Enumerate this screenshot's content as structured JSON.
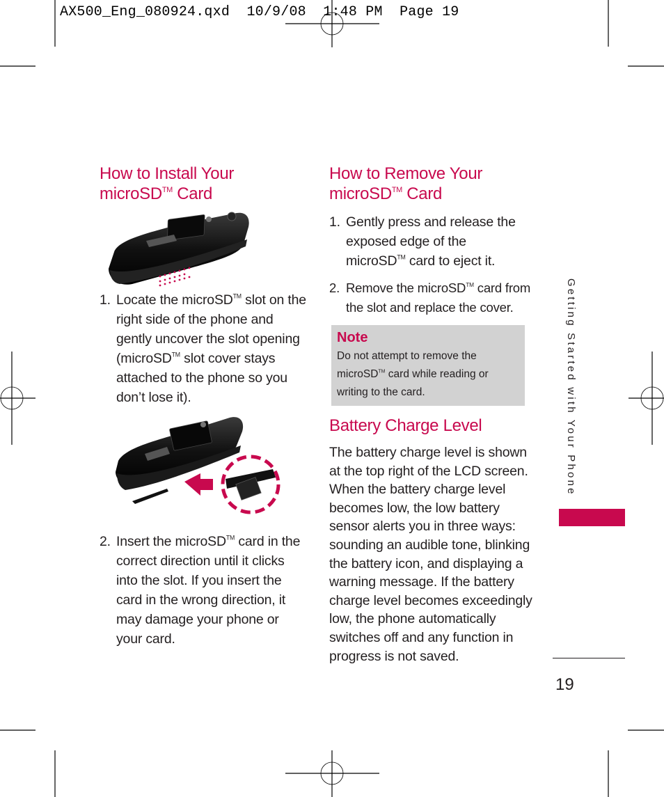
{
  "slug": {
    "text": "AX500_Eng_080924.qxd  10/9/08  1:48 PM  Page 19"
  },
  "colors": {
    "accent": "#c8094e",
    "note_bg": "#d2d2d2",
    "text": "#231f20"
  },
  "install": {
    "heading_line1": "How to Install Your",
    "heading_line2_pre": "microSD",
    "heading_tm": "TM",
    "heading_line2_post": " Card",
    "image1_alt": "Closed flip phone with microSD slot edge highlighted by dotted line",
    "step1": {
      "num": "1.",
      "part1": "Locate the microSD",
      "tm": "TM",
      "part2": " slot on the right side of the phone and gently uncover the slot opening (microSD",
      "tm2": "TM",
      "part3": " slot cover stays attached to the phone so you don’t lose it)."
    },
    "image2_alt": "Phone with arrow showing microSD card insertion into side slot",
    "step2": {
      "num": "2.",
      "part1": "Insert the microSD",
      "tm": "TM",
      "part2": " card in the correct direction until it clicks into the slot. If you insert the card in the wrong direction, it may damage your phone or your card."
    }
  },
  "remove": {
    "heading_line1": "How to Remove Your",
    "heading_line2_pre": "microSD",
    "heading_tm": "TM",
    "heading_line2_post": " Card",
    "step1": {
      "num": "1.",
      "part1": "Gently press and release the exposed edge of the microSD",
      "tm": "TM",
      "part2": " card to eject it."
    },
    "step2": {
      "num": "2.",
      "part1": "Remove the microSD",
      "tm": "TM",
      "part2": " card from the slot and replace the cover."
    }
  },
  "note": {
    "title": "Note",
    "part1": "Do not attempt to remove the microSD",
    "tm": "TM",
    "part2": " card while reading or writing to the card."
  },
  "battery": {
    "heading": "Battery Charge Level",
    "body": "The battery charge level is shown at the top right of the LCD screen. When the battery charge level becomes low, the low battery sensor alerts you in three ways: sounding an audible tone, blinking the battery icon, and displaying a warning message. If the battery charge level becomes exceedingly low, the phone automatically switches off and any function in progress is not saved."
  },
  "sidebar": {
    "section_label": "Getting Started with Your Phone"
  },
  "footer": {
    "page_number": "19"
  }
}
